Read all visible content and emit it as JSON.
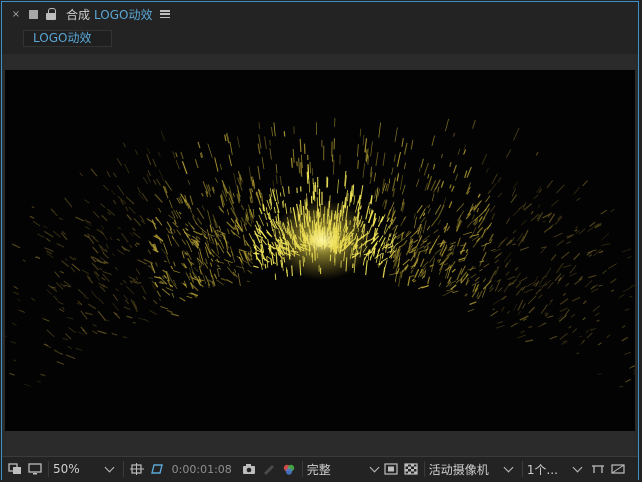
{
  "panel": {
    "close_glyph": "×",
    "tab_prefix": "合成",
    "comp_name": "LOGO动效"
  },
  "subtab": {
    "label": "LOGO动效"
  },
  "bottom_bar": {
    "zoom": "50%",
    "timecode": "0:00:01:08",
    "resolution": "完整",
    "camera": "活动摄像机",
    "views": "1个..."
  },
  "colors": {
    "accent_blue": "#5aa7d6",
    "particle_core": "#f4e85a",
    "particle_mid": "#c9b23a",
    "particle_edge": "#6b5a22"
  }
}
